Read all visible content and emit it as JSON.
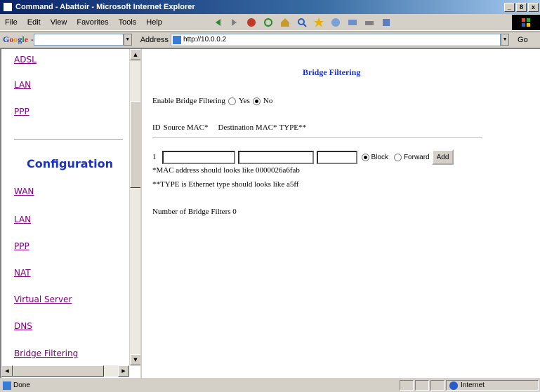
{
  "window": {
    "title": "Command - Abattoir - Microsoft Internet Explorer",
    "min": "_",
    "max": "8",
    "close": "x"
  },
  "menu": [
    "File",
    "Edit",
    "View",
    "Favorites",
    "Tools",
    "Help"
  ],
  "google": {
    "logo_letters": [
      "G",
      "o",
      "o",
      "g",
      "l",
      "e"
    ],
    "dropdown": "-"
  },
  "address": {
    "label": "Address",
    "url": "http://10.0.0.2",
    "go": "Go"
  },
  "left_nav": {
    "top_links": [
      "ADSL",
      "LAN",
      "PPP"
    ],
    "section_heading": "Configuration",
    "config_links": [
      "WAN",
      "LAN",
      "PPP",
      "NAT",
      "Virtual Server",
      "DNS",
      "Bridge Filtering"
    ]
  },
  "main": {
    "title": "Bridge Filtering",
    "enable_label": "Enable Bridge Filtering",
    "enable_yes": "Yes",
    "enable_no": "No",
    "enable_value": "No",
    "col_id": "ID",
    "col_source": "Source MAC*",
    "col_dest": "Destination MAC*",
    "col_type": "TYPE**",
    "row_index": "1",
    "block_label": "Block",
    "forward_label": "Forward",
    "action_value": "Block",
    "add_label": "Add",
    "note_mac": "*MAC address should looks like 0000026a6fab",
    "note_type": "**TYPE is Ethernet type should looks like a5ff",
    "count_text": "Number of Bridge Filters 0"
  },
  "status": {
    "text": "Done",
    "zone": "Internet"
  }
}
